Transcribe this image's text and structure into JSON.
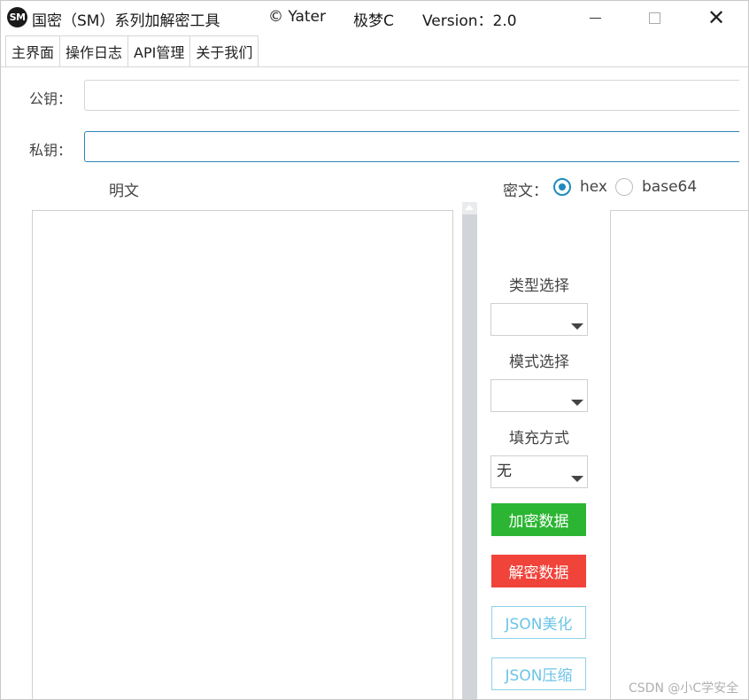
{
  "window": {
    "logo_text": "SM",
    "title": "国密（SM）系列加解密工具",
    "copyright": "© Yater",
    "author": "极梦C",
    "version": "Version：2.0"
  },
  "tabs": [
    {
      "label": "主界面"
    },
    {
      "label": "操作日志"
    },
    {
      "label": "API管理"
    },
    {
      "label": "关于我们"
    }
  ],
  "keys": {
    "public_label": "公钥：",
    "public_value": "",
    "private_label": "私钥：",
    "private_value": ""
  },
  "plaintext": {
    "label": "明文",
    "value": ""
  },
  "ciphertext": {
    "label": "密文：",
    "format_options": [
      {
        "label": "hex",
        "checked": true
      },
      {
        "label": "base64",
        "checked": false
      }
    ],
    "value": ""
  },
  "controls": {
    "type_label": "类型选择",
    "type_value": "",
    "mode_label": "模式选择",
    "mode_value": "",
    "padding_label": "填充方式",
    "padding_value": "无",
    "encrypt_button": "加密数据",
    "decrypt_button": "解密数据",
    "json_beautify_button": "JSON美化",
    "json_compress_button": "JSON压缩"
  },
  "colors": {
    "encrypt": "#2bb532",
    "decrypt": "#f0433a",
    "outline": "#8fd0ea",
    "radio_accent": "#1f8ac0"
  },
  "watermark": "CSDN @小C学安全"
}
